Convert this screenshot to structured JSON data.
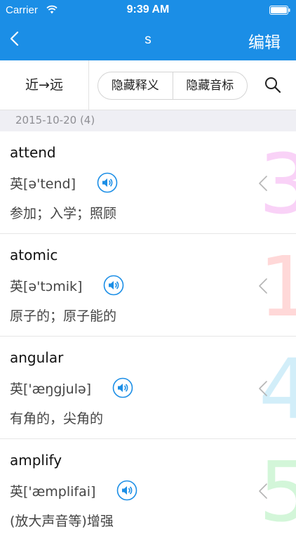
{
  "status_bar": {
    "carrier": "Carrier",
    "time": "9:39 AM"
  },
  "nav": {
    "title": "s",
    "edit_label": "编辑",
    "bg_color": "#1b8ee6"
  },
  "toolbar": {
    "sort_label": "近→远",
    "hide_meaning_label": "隐藏释义",
    "hide_phonetic_label": "隐藏音标",
    "search_icon": "search-icon"
  },
  "date_header": "2015-10-20 (4)",
  "words": [
    {
      "word": "attend",
      "phonetic": "英[ə'tend]",
      "meaning": "参加；入学；照顾",
      "num": "3",
      "num_color": "#f4a6f0"
    },
    {
      "word": "atomic",
      "phonetic": "英[ə'tɔmik]",
      "meaning": "原子的；原子能的",
      "num": "1",
      "num_color": "#ffb3b3"
    },
    {
      "word": "angular",
      "phonetic": "英['æŋgjulə]",
      "meaning": "有角的，尖角的",
      "num": "4",
      "num_color": "#a6dff5"
    },
    {
      "word": "amplify",
      "phonetic": "英['æmplifai]",
      "meaning": "(放大声音等)增强",
      "num": "5",
      "num_color": "#a9efb5"
    }
  ]
}
